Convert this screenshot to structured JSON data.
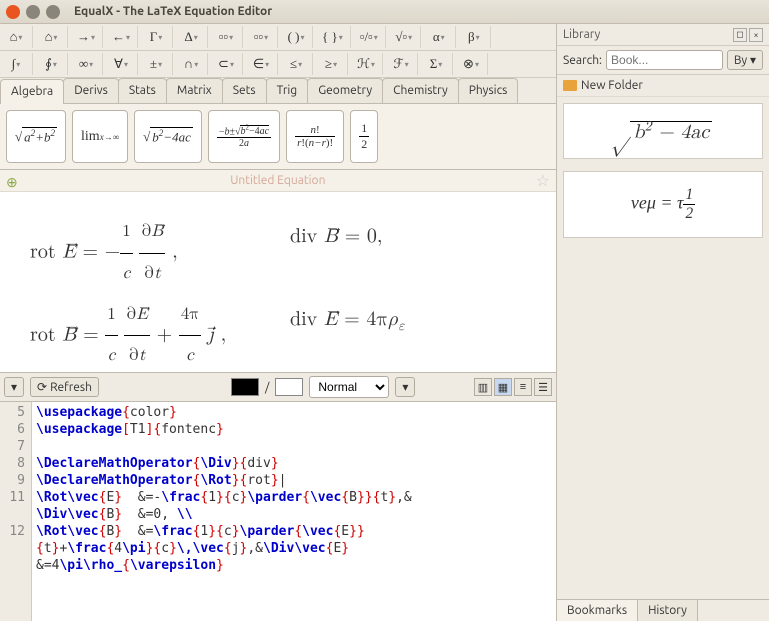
{
  "window": {
    "title": "EqualX - The LaTeX Equation Editor"
  },
  "toolbar_rows": [
    [
      "⌂",
      "⌂",
      "→",
      "←",
      "Γ",
      "Δ",
      "▫▫",
      "▫▫",
      "( )",
      "{ }",
      "▫/▫",
      "√▫",
      "α",
      "β"
    ],
    [
      "∫",
      "∮",
      "∞",
      "∀",
      "±",
      "∩",
      "⊂",
      "∈",
      "≤",
      "≥",
      "ℋ",
      "ℱ",
      "Σ",
      "⊗"
    ]
  ],
  "library": {
    "title": "Library",
    "search_label": "Search:",
    "search_placeholder": "Book...",
    "by_label": "By",
    "folder": "New Folder",
    "preview1_html": "√<span style='border-top:1px solid #000;padding:0 3px'>b<sup>2</sup> − 4ac</span>",
    "preview2_html": "<i>νeμ</i> = <i>τ</i><span class='frac'><span class='num'>1</span><span class='den'>2</span></span>",
    "tabs": [
      "Bookmarks",
      "History"
    ],
    "active_tab": 0
  },
  "categories": [
    "Algebra",
    "Derivs",
    "Stats",
    "Matrix",
    "Sets",
    "Trig",
    "Geometry",
    "Chemistry",
    "Physics"
  ],
  "active_category": 0,
  "templates": [
    "√<span style='border-top:1px solid #000;padding:0 2px;font-style:italic'>a<sup>2</sup>+b<sup>2</sup></span>",
    "<span style='font-size:14px'>lim</span><br><span style='font-size:9px'><i>x</i>→∞</span>",
    "√<span style='border-top:1px solid #000;padding:0 2px;font-style:italic'>b<sup>2</sup>−4ac</span>",
    "<span class='frac' style='font-size:10px'><span class='num'>−<i>b</i>±√<span style='border-top:1px solid #000'><i>b</i><sup>2</sup>−4<i>ac</i></span></span><span class='den'>2<i>a</i></span></span>",
    "<span class='frac' style='font-size:11px'><span class='num'><i>n</i>!</span><span class='den'><i>r</i>!(<i>n−r</i>)!</span></span>",
    "<span class='frac' style='font-size:12px'><span class='num'>1</span><span class='den'>2</span></span>"
  ],
  "equation": {
    "title": "Untitled Equation",
    "lines": [
      {
        "left": "rot <i>E⃗</i> = −<span class='frac'><span class='num'>1</span><span class='den'><i>c</i></span></span> <span class='frac'><span class='num'>∂<i>B⃗</i></span><span class='den'>∂<i>t</i></span></span> ,",
        "right": "div <i>B⃗</i> = 0,"
      },
      {
        "left": "rot <i>B⃗</i> = <span class='frac'><span class='num'>1</span><span class='den'><i>c</i></span></span> <span class='frac'><span class='num'>∂<i>E⃗</i></span><span class='den'>∂<i>t</i></span></span> + <span class='frac'><span class='num'>4π</span><span class='den'><i>c</i></span></span> <i>j⃗</i> ,",
        "right": "div <i>E⃗</i> = 4π<i>ρ<sub>ε</sub></i>"
      }
    ]
  },
  "render_bar": {
    "refresh": "Refresh",
    "mode": "Normal"
  },
  "code": {
    "lines": [
      {
        "n": "5",
        "html": "<span class='kw'>\\usepackage</span><span class='br'>{</span>color<span class='br'>}</span>"
      },
      {
        "n": "6",
        "html": "<span class='kw'>\\usepackage</span><span class='br'>[</span>T1<span class='br'>]{</span>fontenc<span class='br'>}</span>"
      },
      {
        "n": "7",
        "html": ""
      },
      {
        "n": "8",
        "html": "<span class='kw'>\\DeclareMathOperator</span><span class='br'>{</span><span class='kw'>\\Div</span><span class='br'>}{</span>div<span class='br'>}</span>"
      },
      {
        "n": "9",
        "html": "<span class='kw'>\\DeclareMathOperator</span><span class='br'>{</span><span class='kw'>\\Rot</span><span class='br'>}{</span>rot<span class='br'>}</span>|"
      },
      {
        "n": "11",
        "html": "<span class='kw'>\\Rot\\vec</span><span class='br'>{</span>E<span class='br'>}</span>  &=-<span class='kw'>\\frac</span><span class='br'>{</span>1<span class='br'>}{</span>c<span class='br'>}</span><span class='kw'>\\parder</span><span class='br'>{</span><span class='kw'>\\vec</span><span class='br'>{</span>B<span class='br'>}}{</span>t<span class='br'>}</span>,&"
      },
      {
        "n": "",
        "html": "<span class='kw'>\\Div\\vec</span><span class='br'>{</span>B<span class='br'>}</span>  &=0, <span class='kw'>\\\\</span>"
      },
      {
        "n": "12",
        "html": "<span class='kw'>\\Rot\\vec</span><span class='br'>{</span>B<span class='br'>}</span>  &=<span class='kw'>\\frac</span><span class='br'>{</span>1<span class='br'>}{</span>c<span class='br'>}</span><span class='kw'>\\parder</span><span class='br'>{</span><span class='kw'>\\vec</span><span class='br'>{</span>E<span class='br'>}}</span>"
      },
      {
        "n": "",
        "html": "<span class='br'>{</span>t<span class='br'>}</span>+<span class='kw'>\\frac</span><span class='br'>{</span>4<span class='kw'>\\pi</span><span class='br'>}{</span>c<span class='br'>}</span><span class='kw'>\\,\\vec</span><span class='br'>{</span>j<span class='br'>}</span>,&<span class='kw'>\\Div\\vec</span><span class='br'>{</span>E<span class='br'>}</span>"
      },
      {
        "n": "",
        "html": "&=4<span class='kw'>\\pi\\rho_</span><span class='br'>{</span><span class='kw'>\\varepsilon</span><span class='br'>}</span>"
      }
    ]
  }
}
